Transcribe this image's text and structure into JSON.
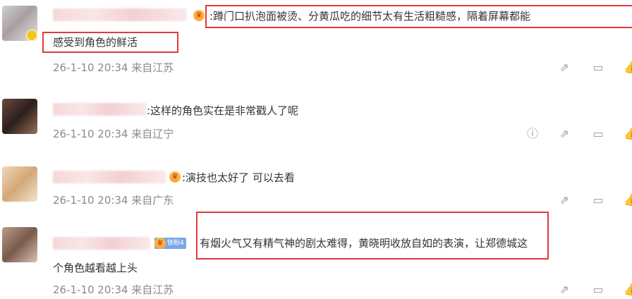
{
  "comments": [
    {
      "text_line1": ":蹲门口扒泡面被烫、分黄瓜吃的细节太有生活粗糙感，隔着屏幕都能",
      "text_line2": "感受到角色的鲜活",
      "meta": "26-1-10 20:34 来自江苏",
      "badge": "crown"
    },
    {
      "text_line1": ":这样的角色实在是非常戳人了呢",
      "meta": "26-1-10 20:34 来自辽宁"
    },
    {
      "text_line1": ":演技也太好了 可以去看",
      "meta": "26-1-10 20:34 来自广东",
      "badge": "crown"
    },
    {
      "text_line1": "有烟火气又有精气神的剧太难得，黄晓明收放自如的表演，让郑德城这",
      "text_line2": "个角色越看越上头",
      "meta": "26-1-10 20:34 来自江苏",
      "badge": "fan",
      "fan_badge_label": "铁粉4"
    }
  ],
  "icons": {
    "report": "report-icon",
    "forward": "forward-icon",
    "reply": "reply-icon",
    "like": "like-icon"
  },
  "colors": {
    "highlight": "#e03a3a",
    "meta_text": "#8a8a8a",
    "icon": "#9a9a9a"
  }
}
